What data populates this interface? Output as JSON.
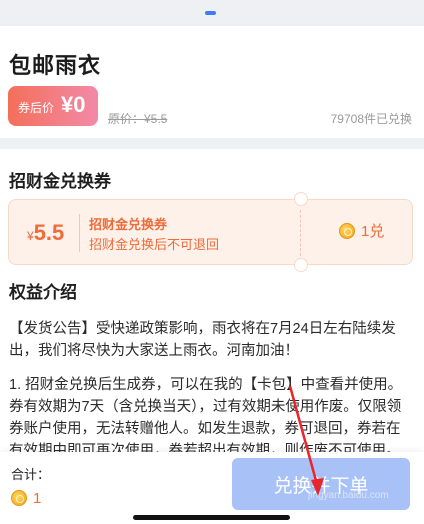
{
  "product": {
    "title": "包邮雨衣",
    "price_label": "券后价",
    "price_value": "¥0",
    "original_price": "原价：¥5.5",
    "sold_count": "79708件已兑换"
  },
  "coupon_section": {
    "title": "招财金兑换券",
    "currency": "¥",
    "amount": "5.5",
    "coupon_name": "招财金兑换券",
    "coupon_desc": "招财金兑换后不可退回",
    "cost": "1兑",
    "coin_icon": "coin-icon"
  },
  "benefits": {
    "title": "权益介绍",
    "paragraph1_line1": "【发货公告】受快递政策影响，雨衣将在7月24日左右陆续发",
    "paragraph1_line2": "出，我们将尽快为大家送上雨衣。河南加油！",
    "paragraph2_line1": "1. 招财金兑换后生成券，可以在我的【卡包】中查看并使用。",
    "paragraph2_line2": "券有效期为7天（含兑换当天），过有效期未使用作废。仅限领",
    "paragraph2_line3": "券账户使用，无法转赠他人。如发生退款，券可退回，券若在",
    "paragraph2_line4": "有效期中即可再次使用，券若超出有效期，则作废不可使用。"
  },
  "footer": {
    "total_label": "合计：",
    "total_value": "1",
    "button_label": "兑换并下单"
  },
  "watermark": "jingyan.baidu.com",
  "colors": {
    "accent": "#ee6b3a",
    "button": "#a8c2f7",
    "annotation_arrow": "#e8262c"
  }
}
